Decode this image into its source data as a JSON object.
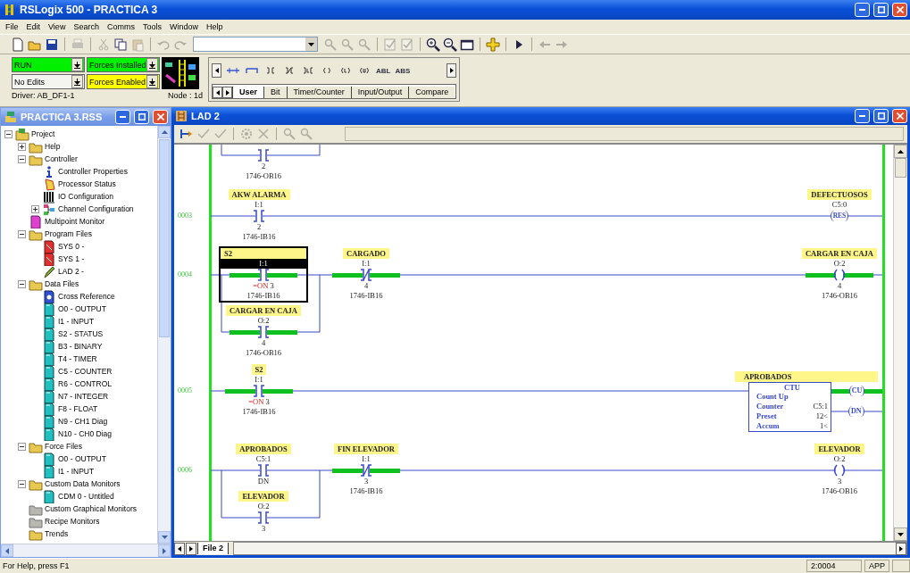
{
  "window": {
    "title": "RSLogix 500 - PRACTICA 3"
  },
  "menu": [
    "File",
    "Edit",
    "View",
    "Search",
    "Comms",
    "Tools",
    "Window",
    "Help"
  ],
  "toolbar": [
    {
      "kind": "new",
      "disabled": false
    },
    {
      "kind": "open",
      "disabled": false
    },
    {
      "kind": "save",
      "disabled": false
    },
    {
      "kind": "sep"
    },
    {
      "kind": "print",
      "disabled": true
    },
    {
      "kind": "sep"
    },
    {
      "kind": "cut",
      "disabled": true
    },
    {
      "kind": "copy",
      "disabled": false
    },
    {
      "kind": "paste",
      "disabled": true
    },
    {
      "kind": "sep"
    },
    {
      "kind": "undo",
      "disabled": true
    },
    {
      "kind": "redo",
      "disabled": true
    },
    {
      "kind": "combo"
    },
    {
      "kind": "find",
      "disabled": true
    },
    {
      "kind": "find",
      "disabled": true
    },
    {
      "kind": "find",
      "disabled": true
    },
    {
      "kind": "sep"
    },
    {
      "kind": "verify",
      "disabled": true
    },
    {
      "kind": "verify",
      "disabled": true
    },
    {
      "kind": "sep"
    },
    {
      "kind": "zoomin",
      "disabled": false
    },
    {
      "kind": "zoomout",
      "disabled": false
    },
    {
      "kind": "window",
      "disabled": false
    },
    {
      "kind": "sep"
    },
    {
      "kind": "add",
      "disabled": false
    },
    {
      "kind": "sep"
    },
    {
      "kind": "run",
      "disabled": false
    },
    {
      "kind": "sep"
    },
    {
      "kind": "back",
      "disabled": true
    },
    {
      "kind": "forward",
      "disabled": true
    }
  ],
  "processor_status": {
    "fields": [
      {
        "text": "RUN",
        "color": "#00f000"
      },
      {
        "text": "Forces Installed",
        "color": "#00f000"
      },
      {
        "text": "No Edits",
        "color": "#f4f4f0"
      },
      {
        "text": "Forces Enabled",
        "color": "#ffff00"
      }
    ],
    "driver": "Driver: AB_DF1-1",
    "node": "Node : 1d"
  },
  "instruction_palette": {
    "items": [
      {
        "kind": "rung"
      },
      {
        "kind": "branch"
      },
      {
        "kind": "xic"
      },
      {
        "kind": "xio"
      },
      {
        "kind": "osr"
      },
      {
        "kind": "ote"
      },
      {
        "kind": "otl"
      },
      {
        "kind": "otu"
      },
      {
        "kind": "text",
        "label": "ABL"
      },
      {
        "kind": "text",
        "label": "ABS"
      }
    ],
    "tabs": [
      {
        "label": "User",
        "selected": true
      },
      {
        "label": "Bit",
        "selected": false
      },
      {
        "label": "Timer/Counter",
        "selected": false
      },
      {
        "label": "Input/Output",
        "selected": false
      },
      {
        "label": "Compare",
        "selected": false
      }
    ]
  },
  "project_window": {
    "title": "PRACTICA 3.RSS",
    "tree": [
      {
        "label": "Project",
        "kind": "project",
        "expanded": true,
        "children": [
          {
            "label": "Help",
            "kind": "folder",
            "expanded": false
          },
          {
            "label": "Controller",
            "kind": "folder",
            "expanded": true,
            "children": [
              {
                "label": "Controller Properties",
                "kind": "info"
              },
              {
                "label": "Processor Status",
                "kind": "status"
              },
              {
                "label": "IO Configuration",
                "kind": "io"
              },
              {
                "label": "Channel Configuration",
                "kind": "channel",
                "expanded": false
              }
            ]
          },
          {
            "label": "Multipoint Monitor",
            "kind": "monitor"
          },
          {
            "label": "Program Files",
            "kind": "folder",
            "expanded": true,
            "children": [
              {
                "label": "SYS 0 -",
                "kind": "sys"
              },
              {
                "label": "SYS 1 -",
                "kind": "sys"
              },
              {
                "label": "LAD 2 -",
                "kind": "lad"
              }
            ]
          },
          {
            "label": "Data Files",
            "kind": "folder",
            "expanded": true,
            "children": [
              {
                "label": "Cross Reference",
                "kind": "xref"
              },
              {
                "label": "O0 - OUTPUT",
                "kind": "data"
              },
              {
                "label": "I1 - INPUT",
                "kind": "data"
              },
              {
                "label": "S2 - STATUS",
                "kind": "data"
              },
              {
                "label": "B3 - BINARY",
                "kind": "data"
              },
              {
                "label": "T4 - TIMER",
                "kind": "data"
              },
              {
                "label": "C5 - COUNTER",
                "kind": "data"
              },
              {
                "label": "R6 - CONTROL",
                "kind": "data"
              },
              {
                "label": "N7 - INTEGER",
                "kind": "data"
              },
              {
                "label": "F8 - FLOAT",
                "kind": "data"
              },
              {
                "label": "N9 - CH1 Diag",
                "kind": "data"
              },
              {
                "label": "N10 - CH0 Diag",
                "kind": "data"
              }
            ]
          },
          {
            "label": "Force Files",
            "kind": "folder",
            "expanded": true,
            "children": [
              {
                "label": "O0 - OUTPUT",
                "kind": "data"
              },
              {
                "label": "I1 - INPUT",
                "kind": "data"
              }
            ]
          },
          {
            "label": "Custom Data Monitors",
            "kind": "folder",
            "expanded": true,
            "children": [
              {
                "label": "CDM 0 - Untitled",
                "kind": "data"
              }
            ]
          },
          {
            "label": "Custom Graphical Monitors",
            "kind": "gfolder"
          },
          {
            "label": "Recipe Monitors",
            "kind": "gfolder"
          },
          {
            "label": "Trends",
            "kind": "folder"
          }
        ]
      }
    ]
  },
  "ladder_window": {
    "title": "LAD 2",
    "toolbar": [
      {
        "kind": "rung",
        "disabled": false
      },
      {
        "kind": "check",
        "disabled": true
      },
      {
        "kind": "check",
        "disabled": true
      },
      {
        "kind": "sep"
      },
      {
        "kind": "wheel",
        "disabled": true
      },
      {
        "kind": "cross",
        "disabled": true
      },
      {
        "kind": "sep"
      },
      {
        "kind": "find",
        "disabled": true
      },
      {
        "kind": "find",
        "disabled": true
      }
    ],
    "rungs": [
      {
        "kind": "fragment",
        "instructions": [
          {
            "kind": "xic",
            "bit": "2",
            "module": "1746-OB16",
            "energized": false,
            "selected": false
          }
        ]
      },
      {
        "kind": "rung",
        "number": "0003",
        "inputs": [
          {
            "kind": "xic",
            "symbol": "AKW ALARMA",
            "address": "I:1",
            "bit": "2",
            "module": "1746-IB16",
            "energized": false,
            "selected": false
          }
        ],
        "outputs": [
          {
            "kind": "res",
            "symbol": "DEFECTUOSOS",
            "address": "C5:0",
            "label": "RES",
            "energized": false,
            "selected": false
          }
        ]
      },
      {
        "kind": "rung",
        "number": "0004",
        "inputs": [
          {
            "kind": "branch",
            "legs": [
              [
                {
                  "kind": "xic",
                  "symbol": "S2",
                  "address": "I:1",
                  "force": "=ON",
                  "bit": "3",
                  "module": "1746-IB16",
                  "energized": true,
                  "selected": true
                }
              ],
              [
                {
                  "kind": "xic",
                  "symbol": "CARGAR EN CAJA",
                  "address": "O:2",
                  "bit": "4",
                  "module": "1746-OB16",
                  "energized": true,
                  "selected": false
                }
              ]
            ]
          },
          {
            "kind": "xio",
            "symbol": "CARGADO",
            "address": "I:1",
            "bit": "4",
            "module": "1746-IB16",
            "energized": true,
            "selected": false
          }
        ],
        "outputs": [
          {
            "kind": "ote",
            "symbol": "CARGAR EN CAJA",
            "address": "O:2",
            "bit": "4",
            "module": "1746-OB16",
            "energized": true,
            "selected": false
          }
        ]
      },
      {
        "kind": "rung",
        "number": "0005",
        "inputs": [
          {
            "kind": "xic",
            "symbol": "S2",
            "address": "I:1",
            "force": "=ON",
            "bit": "3",
            "module": "1746-IB16",
            "energized": true,
            "selected": false
          }
        ],
        "outputs": [
          {
            "kind": "ctu",
            "symbol": "APROBADOS",
            "title": "CTU",
            "caption": "Count Up",
            "params": [
              {
                "name": "Counter",
                "value": "C5:1"
              },
              {
                "name": "Preset",
                "value": "12<"
              },
              {
                "name": "Accum",
                "value": "1<"
              }
            ],
            "bits": [
              {
                "label": "CU",
                "energized": true
              },
              {
                "label": "DN",
                "energized": false
              }
            ],
            "selected": false
          }
        ]
      },
      {
        "kind": "rung",
        "number": "0006",
        "inputs": [
          {
            "kind": "branch",
            "legs": [
              [
                {
                  "kind": "xic",
                  "symbol": "APROBADOS",
                  "address": "C5:1",
                  "bit": "DN",
                  "energized": false,
                  "selected": false
                }
              ],
              [
                {
                  "kind": "xic",
                  "symbol": "ELEVADOR",
                  "address": "O:2",
                  "bit": "3",
                  "energized": false,
                  "selected": false
                }
              ]
            ]
          },
          {
            "kind": "xio",
            "symbol": "FIN ELEVADOR",
            "address": "I:1",
            "bit": "3",
            "module": "1746-IB16",
            "energized": true,
            "selected": false
          }
        ],
        "outputs": [
          {
            "kind": "ote",
            "symbol": "ELEVADOR",
            "address": "O:2",
            "bit": "3",
            "module": "1746-OB16",
            "energized": false,
            "selected": false
          }
        ]
      }
    ],
    "file_tabs": [
      {
        "label": "File 2",
        "selected": true
      }
    ]
  },
  "status_bar": {
    "help": "For Help, press F1",
    "position": "2:0004",
    "mode": "APP"
  }
}
